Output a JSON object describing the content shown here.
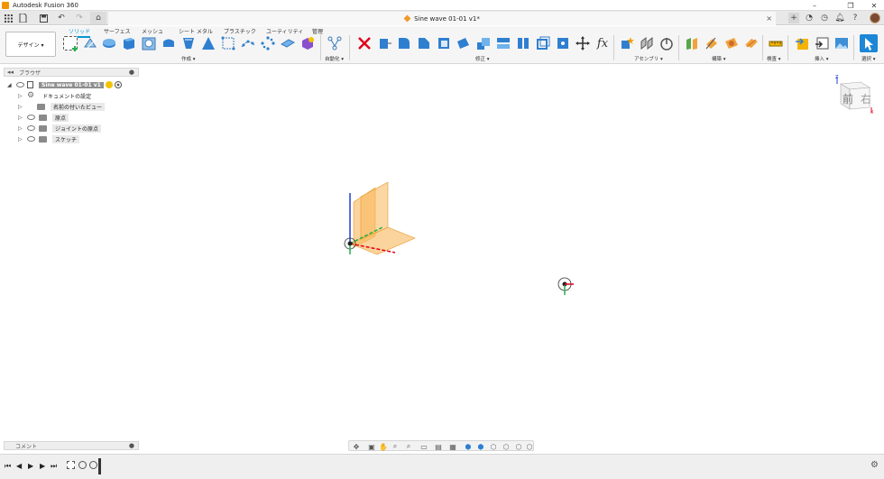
{
  "app": {
    "title": "Autodesk Fusion 360"
  },
  "tabbar": {
    "document_title": "Sine wave 01-01 v1*",
    "close_glyph": "×",
    "plus_glyph": "+"
  },
  "ribbon": {
    "workspace_label": "デザイン ▾",
    "tabs": [
      {
        "label": "ソリッド",
        "active": true
      },
      {
        "label": "サーフェス"
      },
      {
        "label": "メッシュ"
      },
      {
        "label": "シート メタル"
      },
      {
        "label": "プラスチック"
      },
      {
        "label": "ユーティリティ"
      },
      {
        "label": "管理"
      }
    ],
    "groups": {
      "create": "作成 ▾",
      "automate": "自動化 ▾",
      "modify": "修正 ▾",
      "assemble": "アセンブリ ▾",
      "construct": "構築 ▾",
      "inspect": "検査 ▾",
      "insert": "挿入 ▾",
      "select": "選択 ▾"
    },
    "fx_label": "fx"
  },
  "browser": {
    "header": "ブラウザ",
    "items": [
      {
        "label": "Sine wave 01-01 v1",
        "root": true
      },
      {
        "label": "ドキュメントの設定"
      },
      {
        "label": "名前の付いたビュー"
      },
      {
        "label": "原点"
      },
      {
        "label": "ジョイントの原点"
      },
      {
        "label": "スケッチ"
      }
    ]
  },
  "viewcube": {
    "front_label": "前",
    "right_label": "右",
    "z_label": "Z",
    "x_label": "X"
  },
  "comments": {
    "label": "コメント"
  },
  "colors": {
    "accent": "#0696d7",
    "plane": "#f7b75a",
    "axis_x": "#e0001b",
    "axis_y": "#22b14c",
    "axis_z": "#1f3fcf"
  },
  "icons": {
    "grid": "grid-menu-icon",
    "file": "file-icon",
    "save": "save-icon",
    "undo": "undo-icon",
    "redo": "redo-icon",
    "home": "home-icon",
    "help": "help-icon",
    "notify": "notification-icon",
    "online": "online-status-icon",
    "settings": "settings-icon"
  }
}
